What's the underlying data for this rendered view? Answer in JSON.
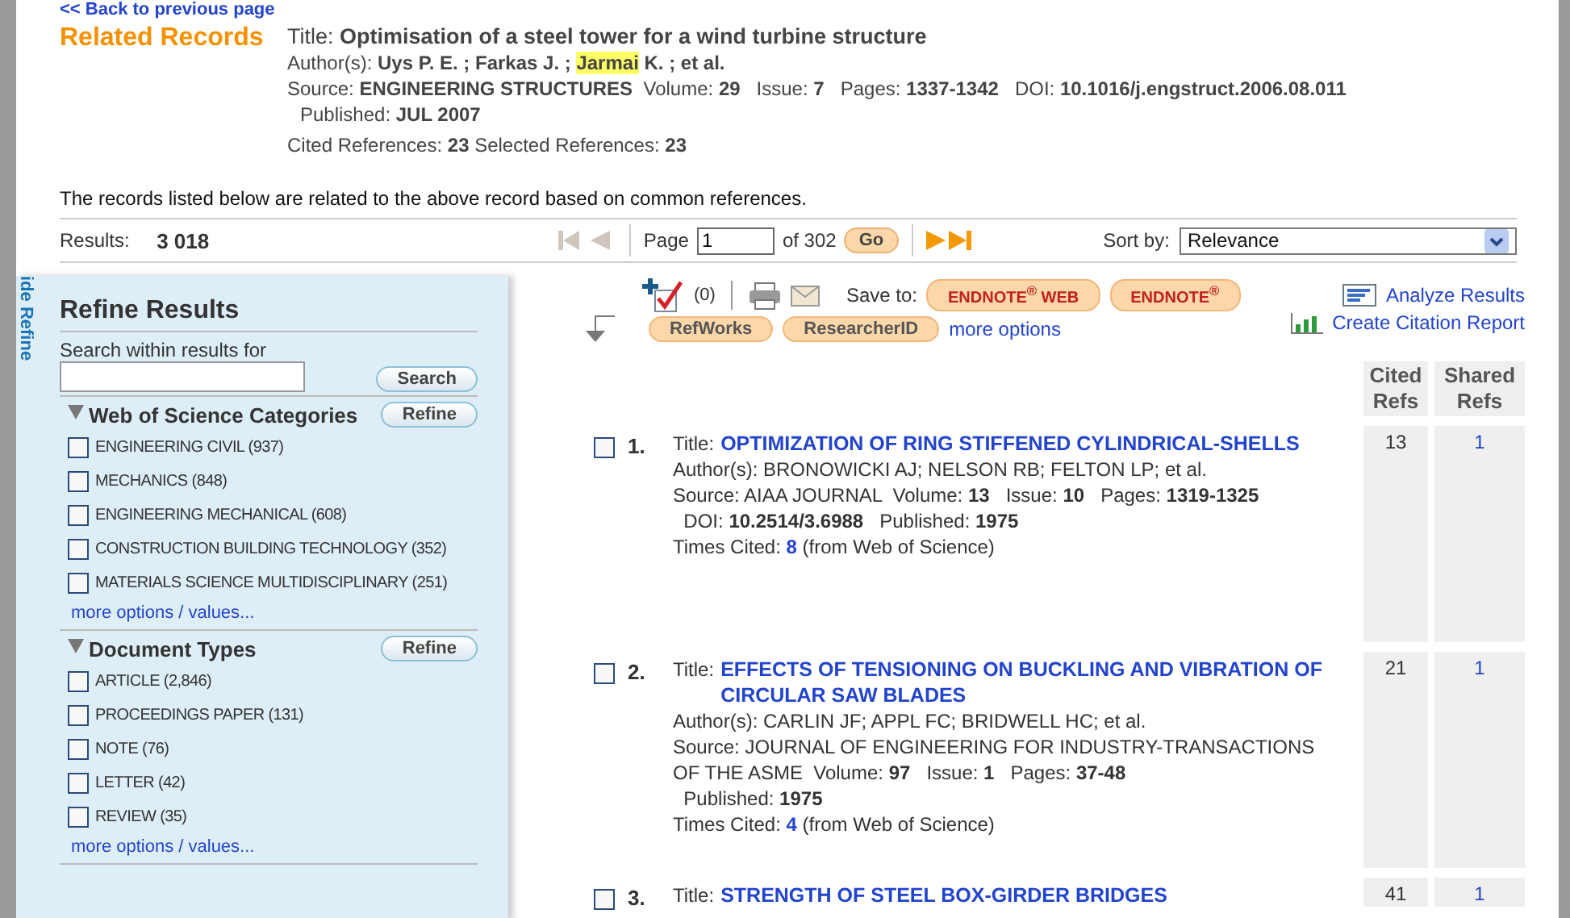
{
  "back_link": "<< Back to previous page",
  "header": {
    "heading": "Related Records",
    "title_line": "Title: **Optimisation of a steel tower for a wind turbine structure**",
    "author_label": "Author(s):",
    "author_segments": [
      {
        "text": "Uys P. E. ; Farkas J. ; ",
        "highlighted": false
      },
      {
        "text": "Jarmai",
        "highlighted": true
      },
      {
        "text": " K. ; et al.",
        "highlighted": false
      }
    ],
    "source_line": "Source: **ENGINEERING STRUCTURES**  Volume: **29**   Issue: **7**   Pages: **1337-1342**   DOI: **10.1016/j.engstruct.2006.08.011**",
    "published_line": "Published: **JUL 2007**",
    "refs_line": "Cited References: **23** Selected References: **23**"
  },
  "intro": "The records listed below are related to the above record based on common references.",
  "results_bar": {
    "label": "Results:",
    "count": "3 018",
    "page_label": "Page",
    "page_value": "1",
    "of_pages": "of 302",
    "go": "Go",
    "sort_label": "Sort by:",
    "sort_value": "Relevance"
  },
  "sidebar": {
    "tab": "ide Refine",
    "title": "Refine Results",
    "search_label": "Search within results for",
    "search_button": "Search",
    "sections": [
      {
        "title": "Web of Science Categories",
        "button": "Refine",
        "more": "more options / values...",
        "items": [
          {
            "label": "ENGINEERING CIVIL (937)",
            "checked": false
          },
          {
            "label": "MECHANICS (848)",
            "checked": false
          },
          {
            "label": "ENGINEERING MECHANICAL (608)",
            "checked": false
          },
          {
            "label": "CONSTRUCTION BUILDING TECHNOLOGY (352)",
            "checked": false
          },
          {
            "label": "MATERIALS SCIENCE MULTIDISCIPLINARY (251)",
            "checked": false
          }
        ]
      },
      {
        "title": "Document Types",
        "button": "Refine",
        "more": "more options / values...",
        "items": [
          {
            "label": "ARTICLE (2,846)",
            "checked": false
          },
          {
            "label": "PROCEEDINGS PAPER (131)",
            "checked": false
          },
          {
            "label": "NOTE (76)",
            "checked": false
          },
          {
            "label": "LETTER (42)",
            "checked": false
          },
          {
            "label": "REVIEW (35)",
            "checked": false
          }
        ]
      }
    ]
  },
  "toolbar": {
    "marked_count": "(0)",
    "save_label": "Save to:",
    "save_buttons": [
      "ENDNOTE$^{®}$ WEB",
      "ENDNOTE$^{®}$"
    ],
    "more_buttons": [
      "RefWorks",
      "ResearcherID"
    ],
    "more_options": "more options",
    "analyze": "Analyze Results",
    "citation_report": "Create Citation Report"
  },
  "columns": [
    "Cited Refs",
    "Shared Refs"
  ],
  "records": [
    {
      "number": "1.",
      "checked": false,
      "title_label": "Title:",
      "title": "OPTIMIZATION OF RING STIFFENED CYLINDRICAL-SHELLS",
      "authors": "Author(s): BRONOWICKI AJ; NELSON RB; FELTON LP; et al.",
      "lines": [
        "Source: AIAA JOURNAL  Volume: **13**   Issue: **10**   Pages: **1319-1325**",
        "  DOI: **10.2514/3.6988**   Published: **1975**"
      ],
      "cited_prefix": "Times Cited:",
      "cited_count": "8",
      "cited_suffix": "(from Web of Science)",
      "cited_refs": "13",
      "shared_refs": "1"
    },
    {
      "number": "2.",
      "checked": false,
      "title_label": "Title:",
      "title": "EFFECTS OF TENSIONING ON BUCKLING AND VIBRATION OF CIRCULAR SAW BLADES",
      "authors": "Author(s): CARLIN JF; APPL FC; BRIDWELL HC; et al.",
      "lines": [
        "Source: JOURNAL OF ENGINEERING FOR INDUSTRY-TRANSACTIONS OF THE ASME  Volume: **97**   Issue: **1**   Pages: **37-48**",
        "  Published: **1975**"
      ],
      "cited_prefix": "Times Cited:",
      "cited_count": "4",
      "cited_suffix": "(from Web of Science)",
      "cited_refs": "21",
      "shared_refs": "1"
    },
    {
      "number": "3.",
      "checked": false,
      "title_label": "Title:",
      "title": "STRENGTH OF STEEL BOX-GIRDER BRIDGES",
      "cited_refs": "41",
      "shared_refs": "1"
    }
  ]
}
